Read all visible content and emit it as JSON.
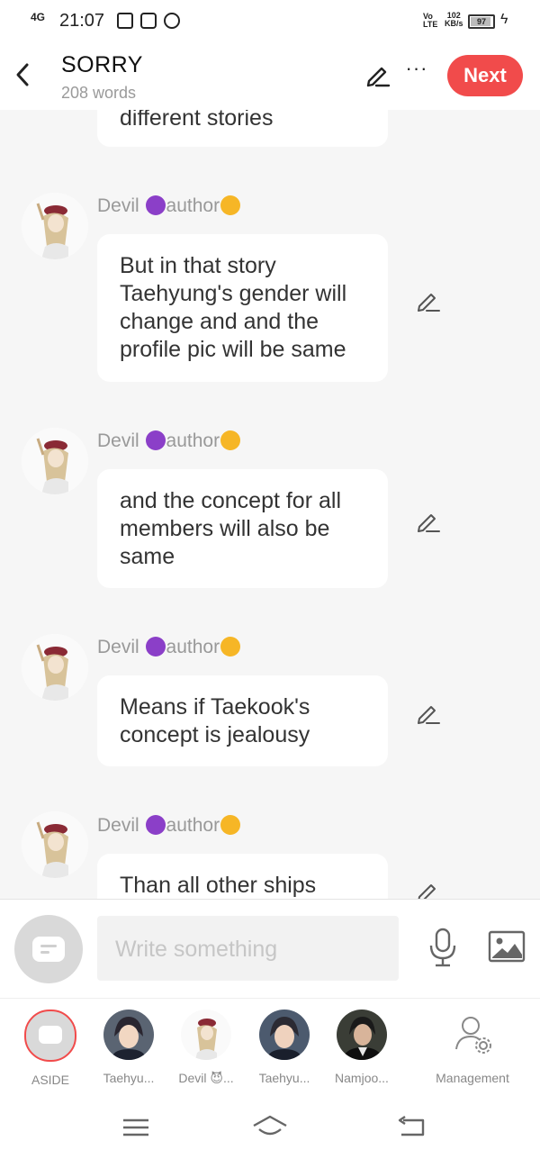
{
  "status_bar": {
    "network": "4G",
    "time": "21:07",
    "volte": "Vo\nLTE",
    "speed_value": "102",
    "speed_unit": "KB/s",
    "battery": "97"
  },
  "header": {
    "title": "SORRY",
    "word_count": "208 words",
    "next_label": "Next",
    "more_label": "···"
  },
  "messages": [
    {
      "text": "different stories"
    },
    {
      "sender_name": "Devil",
      "sender_suffix": "author",
      "text": "But in that story Taehyung's gender will change and and the profile pic will be same"
    },
    {
      "sender_name": "Devil",
      "sender_suffix": "author",
      "text": "and the concept for all members will also be same"
    },
    {
      "sender_name": "Devil",
      "sender_suffix": "author",
      "text": "Means if Taekook's concept is jealousy"
    },
    {
      "sender_name": "Devil",
      "sender_suffix": "author",
      "text": "Than all other ships"
    }
  ],
  "composer": {
    "placeholder": "Write something"
  },
  "cast": [
    {
      "name": "ASIDE"
    },
    {
      "name": "Taehyu..."
    },
    {
      "name": "Devil 😈..."
    },
    {
      "name": "Taehyu..."
    },
    {
      "name": "Namjoo..."
    },
    {
      "name": "Management"
    }
  ],
  "colors": {
    "accent": "#f14b4b",
    "background": "#f6f6f6",
    "bubble": "#ffffff",
    "muted_text": "#999999"
  },
  "icons": [
    "back-arrow-icon",
    "pencil-icon",
    "more-icon",
    "aside-icon",
    "microphone-icon",
    "image-icon",
    "management-icon",
    "menu-icon",
    "home-icon",
    "back-icon",
    "devil-emoji-icon",
    "kiss-emoji-icon"
  ]
}
